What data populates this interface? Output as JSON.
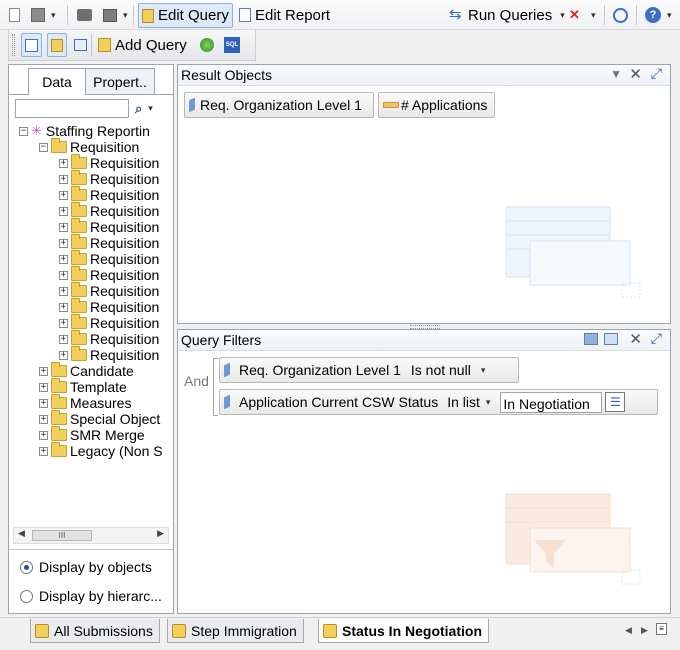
{
  "toolbar": {
    "edit_query": "Edit Query",
    "edit_report": "Edit Report",
    "run_queries": "Run Queries",
    "add_query": "Add Query"
  },
  "left_panel": {
    "tabs": [
      "Data",
      "Propert.."
    ],
    "search_placeholder": "",
    "tree": {
      "root": "Staffing Reportin",
      "open_folder": "Requisition",
      "req_children": [
        "Requisition",
        "Requisition",
        "Requisition",
        "Requisition",
        "Requisition",
        "Requisition",
        "Requisition",
        "Requisition",
        "Requisition",
        "Requisition",
        "Requisition",
        "Requisition",
        "Requisition"
      ],
      "folders": [
        "Candidate",
        "Template",
        "Measures",
        "Special Object",
        "SMR Merge",
        "Legacy (Non S"
      ]
    },
    "scroll_label": "III",
    "display_by_objects": "Display by objects",
    "display_by_hierarchy": "Display by hierarc..."
  },
  "result_objects": {
    "title": "Result Objects",
    "chips": [
      {
        "label": "Req. Organization Level 1",
        "kind": "dimension"
      },
      {
        "label": "# Applications",
        "kind": "measure"
      }
    ]
  },
  "query_filters": {
    "title": "Query Filters",
    "and_label": "And",
    "filters": [
      {
        "object": "Req. Organization Level 1",
        "operator": "Is not null"
      },
      {
        "object": "Application Current CSW Status",
        "operator": "In list",
        "value": "In Negotiation"
      }
    ]
  },
  "bottom_tabs": [
    "All Submissions",
    "Step Immigration",
    "Status In Negotiation"
  ],
  "colors": {
    "accent": "#8fb1dc",
    "dimension": "#6d9bd1",
    "measure": "#f2c26b",
    "folder": "#f3cf5c"
  }
}
